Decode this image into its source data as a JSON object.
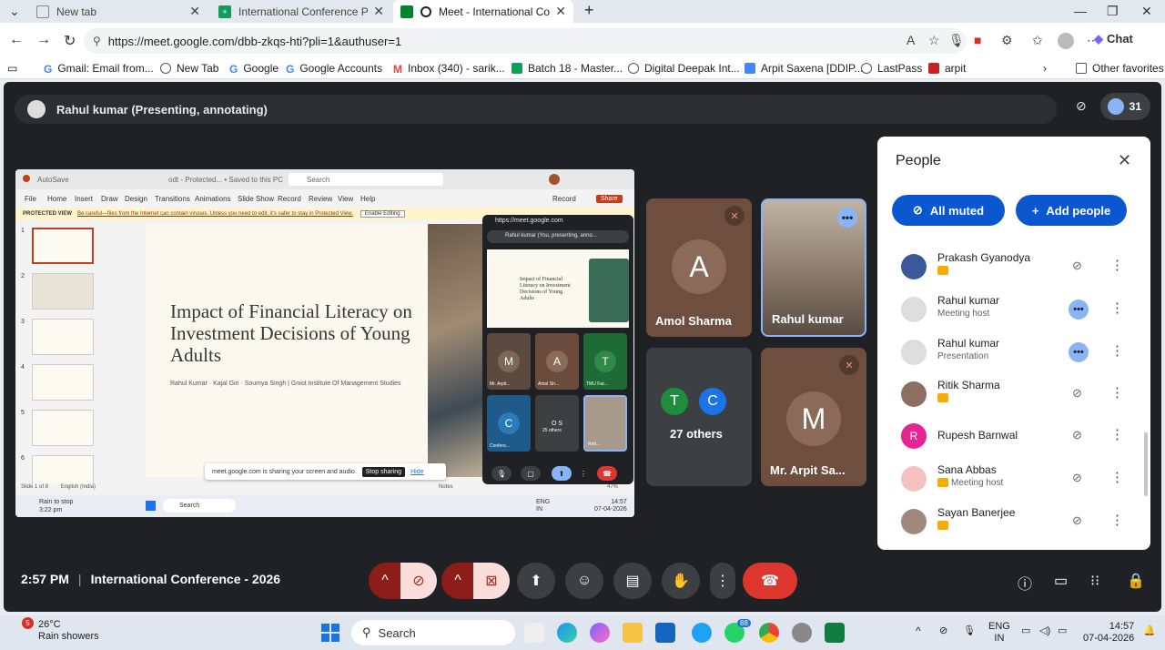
{
  "browser": {
    "tabs": [
      {
        "label": "New tab"
      },
      {
        "label": "International Conference Paper Pr"
      },
      {
        "label": "Meet - International Conferen"
      }
    ],
    "url": "https://meet.google.com/dbb-zkqs-hti?pli=1&authuser=1",
    "chat_label": "Chat",
    "bookmarks": [
      "Gmail: Email from...",
      "New Tab",
      "Google",
      "Google Accounts",
      "Inbox (340) - sarik...",
      "Batch 18 - Master...",
      "Digital Deepak Int...",
      "Arpit Saxena [DDIP...",
      "LastPass",
      "arpit"
    ],
    "other_favorites": "Other favorites"
  },
  "meet": {
    "presenter_label": "Rahul kumar (Presenting, annotating)",
    "participant_count": "31",
    "time": "2:57 PM",
    "meeting_title": "International Conference - 2026",
    "shared": {
      "autosave": "AutoSave",
      "search": "Search",
      "saved": "odt - Protected... • Saved to this PC",
      "menu": [
        "File",
        "Home",
        "Insert",
        "Draw",
        "Design",
        "Transitions",
        "Animations",
        "Slide Show",
        "Record",
        "Review",
        "View",
        "Help"
      ],
      "record": "Record",
      "share": "Share",
      "protected_label": "PROTECTED VIEW",
      "protected_msg": "Be careful—files from the Internet can contain viruses. Unless you need to edit, it's safer to stay in Protected View.",
      "enable_editing": "Enable Editing",
      "slide_title": "Impact of Financial Literacy on Investment Decisions of Young Adults",
      "slide_authors": "Rahul Kumar · Kajal Giri · Soumya Singh | Gniot Institute Of Management Studies",
      "sharing_msg": "meet.google.com is sharing your screen and audio.",
      "stop_sharing": "Stop sharing",
      "hide": "Hide",
      "status_left": "Slide 1 of 8",
      "status_lang": "English (India)",
      "notes": "Notes",
      "weather_small": "Rain to stop",
      "weather_time": "3:22 pm",
      "inner_search": "Search",
      "inner_lang": "ENG",
      "inner_region": "IN",
      "inner_time": "14:57",
      "inner_date": "07-04-2026",
      "zoom": "47%"
    },
    "pip": {
      "url": "https://meet.google.com",
      "bar": "Rahul kumar (You, presenting, anno...",
      "slide_text": "Impact of Financial Literacy on Investment Decisions of Young Adults",
      "tiles": [
        {
          "initial": "M",
          "label": "Mr. Arpit..."
        },
        {
          "initial": "A",
          "label": "Amol Sh..."
        },
        {
          "initial": "T",
          "label": "TMU Fac..."
        },
        {
          "initial": "C",
          "label": "Confere..."
        },
        {
          "initial": "O S",
          "label": "25 others"
        },
        {
          "initial": "",
          "label": "Rah..."
        }
      ]
    },
    "tiles": [
      {
        "initial": "A",
        "name": "Amol Sharma"
      },
      {
        "initial": "",
        "name": "Rahul kumar"
      },
      {
        "initial": "T C",
        "name": "27 others"
      },
      {
        "initial": "M",
        "name": "Mr. Arpit Sa..."
      }
    ],
    "others_initials": [
      "T",
      "C"
    ],
    "people": {
      "title": "People",
      "all_muted": "All muted",
      "add_people": "Add people",
      "rows": [
        {
          "name": "Prakash Gyanodya",
          "sub": ""
        },
        {
          "name": "Rahul kumar",
          "sub": "Meeting host"
        },
        {
          "name": "Rahul kumar",
          "sub": "Presentation"
        },
        {
          "name": "Ritik Sharma",
          "sub": ""
        },
        {
          "name": "Rupesh Barnwal",
          "sub": "",
          "initial": "R"
        },
        {
          "name": "Sana Abbas",
          "sub": "Meeting host"
        },
        {
          "name": "Sayan Banerjee",
          "sub": ""
        }
      ]
    }
  },
  "taskbar": {
    "weather_temp": "26°C",
    "weather_desc": "Rain showers",
    "weather_badge": "5",
    "search": "Search",
    "whatsapp_badge": "88",
    "lang": "ENG",
    "region": "IN",
    "time": "14:57",
    "date": "07-04-2026"
  },
  "colors": {
    "meet_bg": "#202124",
    "accent_blue": "#0b57d0",
    "end_call": "#dc362e",
    "muted_red": "#f9dedc",
    "ppt_accent": "#c43e1c"
  }
}
